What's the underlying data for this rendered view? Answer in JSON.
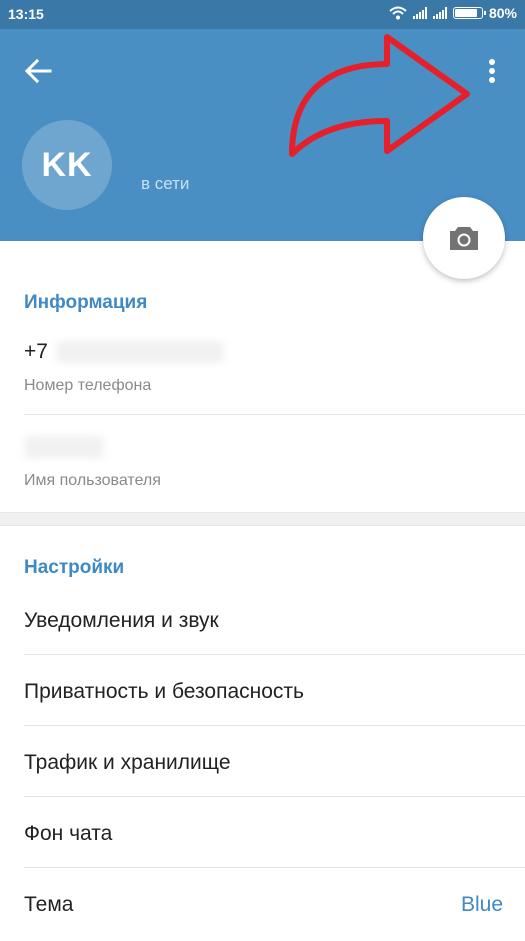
{
  "status_bar": {
    "time": "13:15",
    "battery": "80%",
    "icons": [
      "wifi-icon",
      "signal-icon",
      "signal-icon",
      "battery-icon"
    ]
  },
  "header": {
    "avatar_initials": "KK",
    "status": "в сети",
    "background_color": "#4a8fc3"
  },
  "info": {
    "title": "Информация",
    "phone_prefix": "+7",
    "phone_label": "Номер телефона",
    "username_label": "Имя пользователя"
  },
  "settings": {
    "title": "Настройки",
    "items": [
      {
        "label": "Уведомления и звук"
      },
      {
        "label": "Приватность и безопасность"
      },
      {
        "label": "Трафик и хранилище"
      },
      {
        "label": "Фон чата"
      },
      {
        "label": "Тема",
        "value": "Blue"
      }
    ]
  },
  "accent_color": "#3f8ac4",
  "annotation_color": "#e5202a"
}
